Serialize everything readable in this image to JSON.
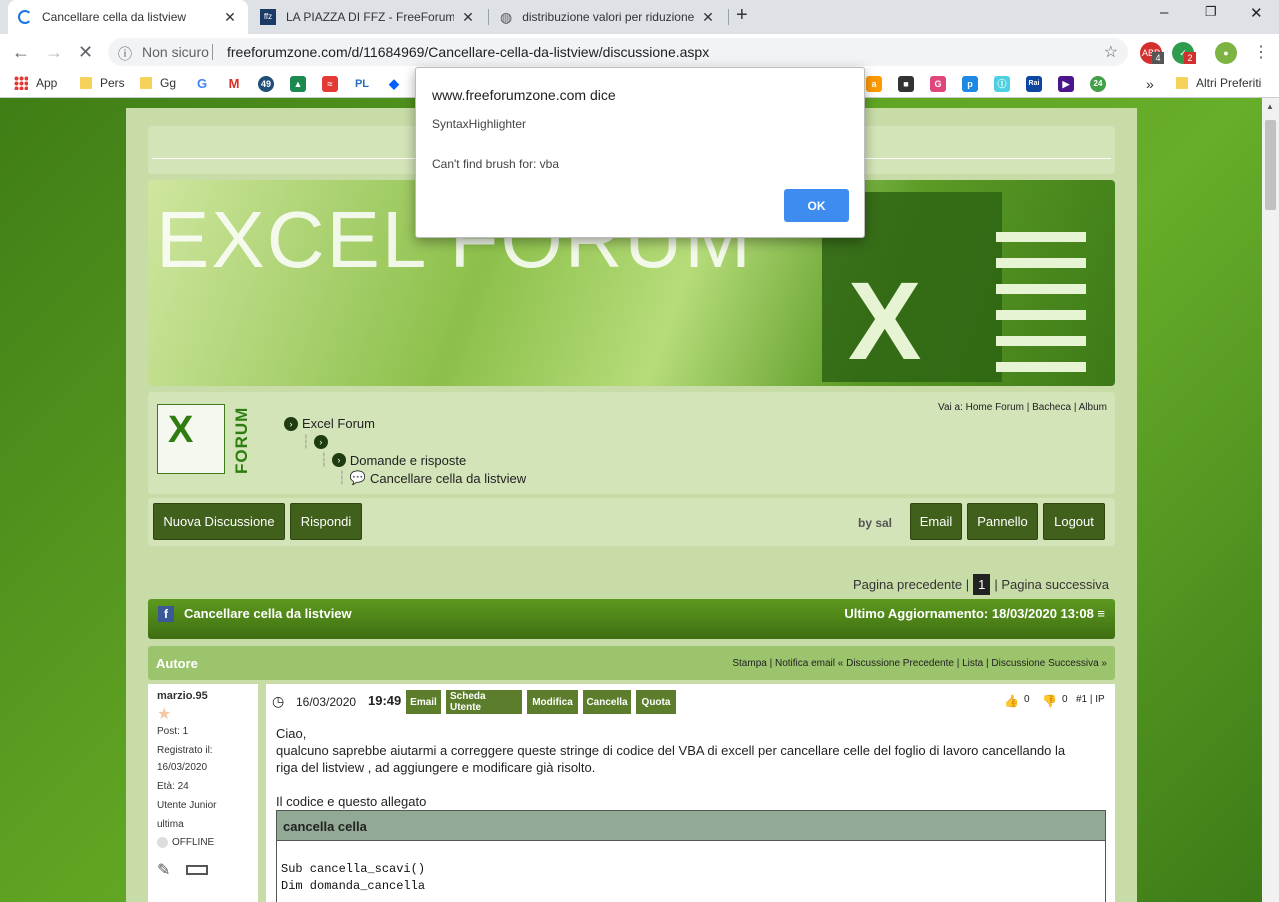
{
  "tabs": [
    {
      "title": "Cancellare cella da listview"
    },
    {
      "title": "LA PIAZZA DI FFZ - FreeForumZo",
      "favicon": "ffz"
    },
    {
      "title": "distribuzione valori per riduzione"
    }
  ],
  "window_controls": {
    "minimize": "–",
    "maximize": "❐",
    "close": "✕",
    "new_tab": "+"
  },
  "omnibox": {
    "security": "Non sicuro",
    "url": "freeforumzone.com/d/11684969/Cancellare-cella-da-listview/discussione.aspx"
  },
  "extensions": {
    "abp_badge": "4",
    "shield_badge": "2"
  },
  "bookmarks": {
    "app_label": "App",
    "pers": "Pers",
    "gg": "Gg",
    "icons": [
      "G",
      "M",
      "49",
      "▲",
      "≈",
      "PL",
      "◆"
    ],
    "icons2": [
      "a",
      "■",
      "G",
      "p",
      "Ⓘ",
      "Rai",
      "▶",
      "24"
    ],
    "more": "»",
    "altri": "Altri Preferiti"
  },
  "banner": {
    "text": "EXCEL FORUM",
    "x_letter": "X"
  },
  "logo": {
    "letter": "X",
    "vertical": "FORUM"
  },
  "nav": {
    "crumb1": "Excel Forum",
    "crumb3": "Domande e risposte",
    "crumb4": "Cancellare cella da listview",
    "vai": "Vai a: Home Forum | Bacheca | Album"
  },
  "actions": {
    "nuova": "Nuova Discussione",
    "rispondi": "Rispondi",
    "bysal": "by sal",
    "email": "Email",
    "pannello": "Pannello",
    "logout": "Logout"
  },
  "pager": {
    "prev": "Pagina precedente |",
    "current": "1",
    "next": "| Pagina successiva"
  },
  "thread": {
    "title": "Cancellare cella da listview",
    "updated": "Ultimo Aggiornamento: 18/03/2020 13:08 ≡",
    "author_label": "Autore",
    "links": "Stampa | Notifica email    « Discussione Precedente | Lista | Discussione Successiva »"
  },
  "author": {
    "name": "marzio.95",
    "posts": "Post: 1",
    "registered_label": "Registrato il:",
    "registered": "16/03/2020",
    "age": "Età: 24",
    "level": "Utente Junior",
    "last": "ultima",
    "status": "OFFLINE"
  },
  "post": {
    "date": "16/03/2020",
    "time": "19:49",
    "buttons": [
      "Email",
      "Scheda Utente",
      "Modifica",
      "Cancella",
      "Quota"
    ],
    "likes": "0",
    "dislikes": "0",
    "number": "#1 | IP",
    "line1": "Ciao,",
    "line2": "qualcuno saprebbe aiutarmi a correggere queste stringe di codice del VBA di excell per cancellare celle del foglio di lavoro cancellando la",
    "line3": "riga del listview , ad aggiungere e modificare già risolto.",
    "line4": "Il codice e questo allegato",
    "code_title": "cancella cella",
    "code": "Sub cancella_scavi()\nDim domanda_cancella"
  },
  "dialog": {
    "host": "www.freeforumzone.com dice",
    "source": "SyntaxHighlighter",
    "message": "Can't find brush for: vba",
    "ok": "OK"
  }
}
